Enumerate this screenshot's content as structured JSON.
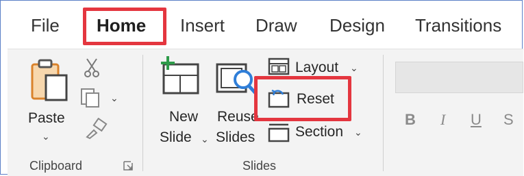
{
  "tabs": [
    {
      "label": "File"
    },
    {
      "label": "Home",
      "active": true
    },
    {
      "label": "Insert"
    },
    {
      "label": "Draw"
    },
    {
      "label": "Design"
    },
    {
      "label": "Transitions"
    }
  ],
  "clipboard": {
    "paste_label": "Paste",
    "group_label": "Clipboard",
    "chevron": "⌄"
  },
  "slides": {
    "new_slide_line1": "New",
    "new_slide_line2": "Slide",
    "reuse_line1": "Reuse",
    "reuse_line2": "Slides",
    "layout_label": "Layout",
    "reset_label": "Reset",
    "section_label": "Section",
    "group_label": "Slides",
    "dropdown_chevron": "⌄"
  },
  "font": {
    "bold": "B",
    "italic": "I",
    "underline": "U",
    "strike": "S"
  },
  "colors": {
    "highlight": "#e4363f",
    "accent_green": "#2e9b4a",
    "accent_blue": "#2f7ed8",
    "paste_orange": "#d9822b"
  }
}
